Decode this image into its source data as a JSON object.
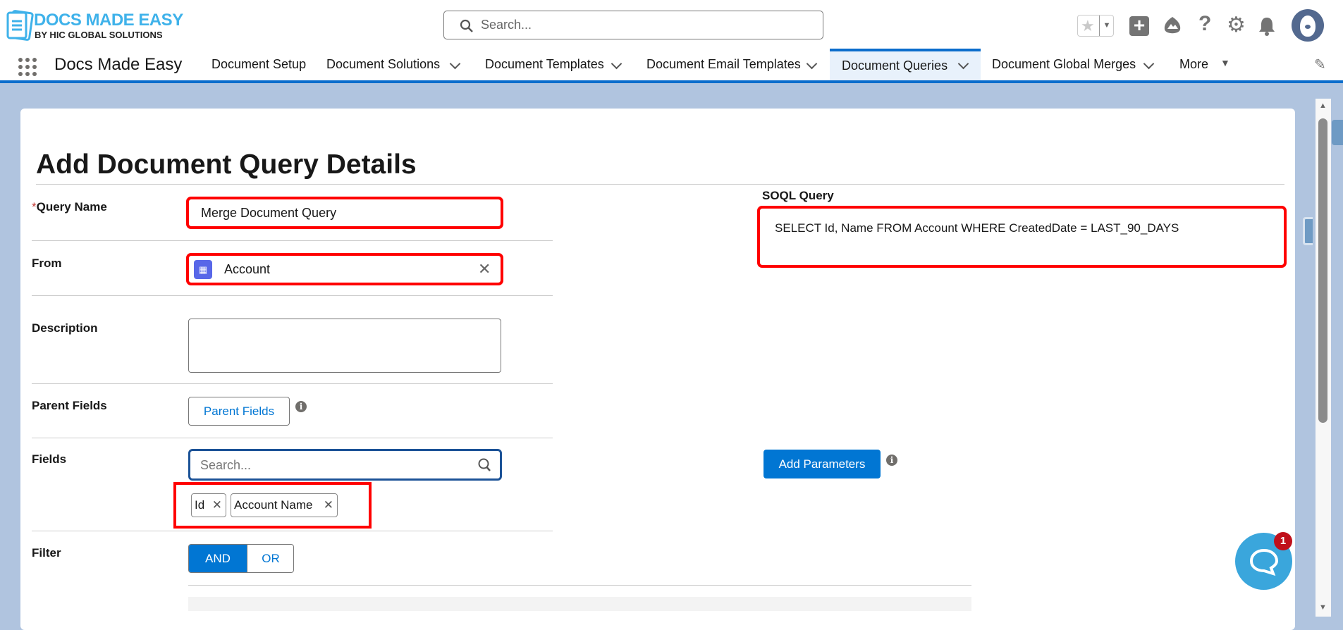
{
  "header": {
    "logo_title": "DOCS MADE EASY",
    "logo_subtitle": "BY HIC GLOBAL SOLUTIONS",
    "search_placeholder": "Search..."
  },
  "nav": {
    "app_name": "Docs Made Easy",
    "tabs": [
      {
        "label": "Document Setup"
      },
      {
        "label": "Document Solutions"
      },
      {
        "label": "Document Templates"
      },
      {
        "label": "Document Email Templates"
      },
      {
        "label": "Document Queries",
        "active": true
      },
      {
        "label": "Document Global Merges"
      },
      {
        "label": "More"
      }
    ]
  },
  "form": {
    "title": "Add Document Query Details",
    "required_mark": "*",
    "query_name_label": "Query Name",
    "query_name_value": "Merge Document Query",
    "from_label": "From",
    "from_value": "Account",
    "description_label": "Description",
    "description_value": "",
    "parent_fields_label": "Parent Fields",
    "parent_fields_button": "Parent Fields",
    "fields_label": "Fields",
    "fields_search_placeholder": "Search...",
    "selected_fields": [
      "Id",
      "Account Name"
    ],
    "filter_label": "Filter",
    "filter_options": [
      "AND",
      "OR"
    ],
    "filter_selected": "AND",
    "soql_label": "SOQL Query",
    "soql_value": "SELECT Id, Name FROM Account WHERE CreatedDate = LAST_90_DAYS",
    "add_parameters_button": "Add Parameters"
  },
  "chat": {
    "badge_count": "1"
  },
  "colors": {
    "brand": "#0176d3",
    "highlight": "#ff0000",
    "background": "#b0c4df"
  }
}
